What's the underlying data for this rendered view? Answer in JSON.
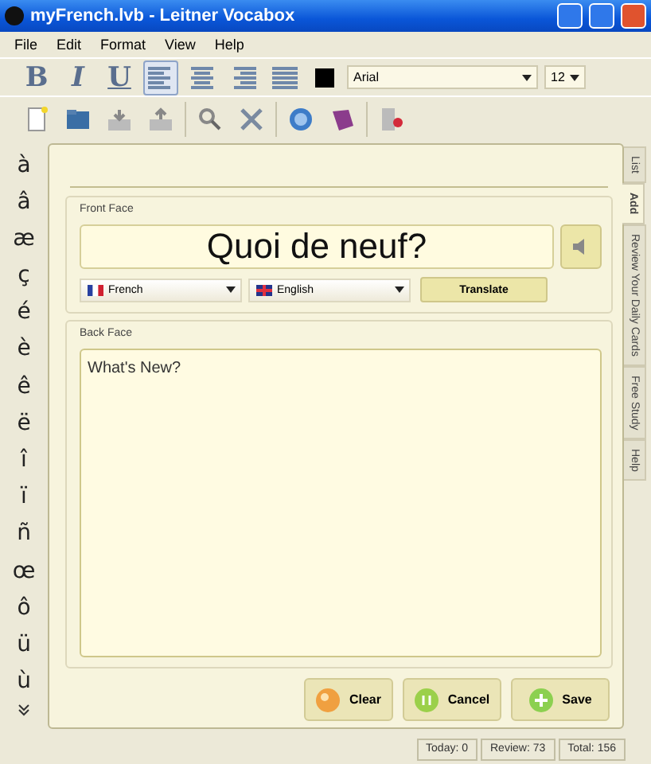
{
  "window": {
    "title": "myFrench.lvb - Leitner Vocabox"
  },
  "menu": [
    "File",
    "Edit",
    "Format",
    "View",
    "Help"
  ],
  "format_toolbar": {
    "styles": [
      {
        "kind": "bold",
        "label": "B"
      },
      {
        "kind": "italic",
        "label": "I"
      },
      {
        "kind": "underline",
        "label": "U"
      }
    ],
    "alignments": [
      {
        "kind": "left",
        "selected": true
      },
      {
        "kind": "center",
        "selected": false
      },
      {
        "kind": "right",
        "selected": false
      },
      {
        "kind": "justify",
        "selected": false
      }
    ],
    "font": "Arial",
    "size": "12"
  },
  "special_chars": [
    "à",
    "â",
    "æ",
    "ç",
    "é",
    "è",
    "ê",
    "ë",
    "î",
    "ï",
    "ñ",
    "œ",
    "ô",
    "ü",
    "ù"
  ],
  "side_tabs": [
    {
      "label": "List",
      "selected": false
    },
    {
      "label": "Add",
      "selected": true
    },
    {
      "label": "Review Your Daily Cards",
      "selected": false
    },
    {
      "label": "Free Study",
      "selected": false
    },
    {
      "label": "Help",
      "selected": false
    }
  ],
  "front_face": {
    "label": "Front Face",
    "text": "Quoi de neuf?",
    "source_language": "French",
    "target_language": "English",
    "translate": "Translate"
  },
  "back_face": {
    "label": "Back Face",
    "text": "What's New?"
  },
  "buttons": [
    {
      "kind": "clear",
      "label": "Clear"
    },
    {
      "kind": "cancel",
      "label": "Cancel"
    },
    {
      "kind": "save",
      "label": "Save"
    }
  ],
  "status": [
    "Today: 0",
    "Review: 73",
    "Total: 156"
  ]
}
